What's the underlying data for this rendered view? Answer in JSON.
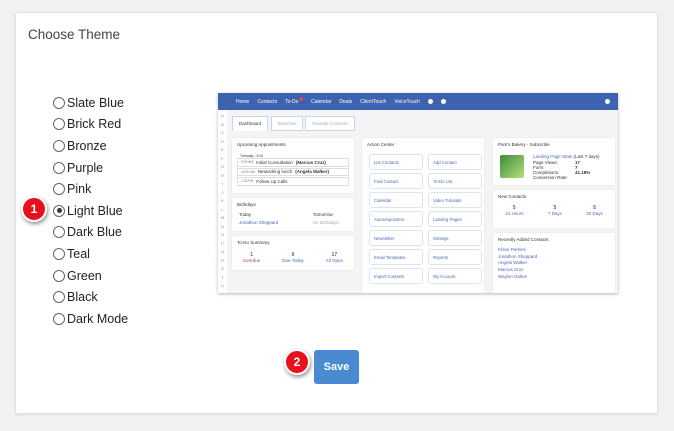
{
  "title": "Choose Theme",
  "themes": [
    "Slate Blue",
    "Brick Red",
    "Bronze",
    "Purple",
    "Pink",
    "Light Blue",
    "Dark Blue",
    "Teal",
    "Green",
    "Black",
    "Dark Mode"
  ],
  "selected_theme": "Light Blue",
  "badges": [
    "1",
    "2"
  ],
  "save_label": "Save",
  "preview": {
    "nav": [
      "Home",
      "Contacts",
      "To-Do",
      "Calendar",
      "Deals",
      "ClientTouch",
      "VoiceTouch"
    ],
    "todo_badges": [
      "1",
      "6"
    ],
    "alpha": [
      "A",
      "B",
      "C",
      "D",
      "E",
      "F",
      "G",
      "H",
      "I",
      "J",
      "K",
      "L",
      "M",
      "N",
      "O",
      "P",
      "Q",
      "R",
      "S",
      "T",
      "U"
    ],
    "tabs": [
      "Dashboard",
      "Searches",
      "Favorite Contacts"
    ],
    "appointments": {
      "title": "Upcoming Appointments",
      "date": "Tuesday - 4/10",
      "items": [
        {
          "time": "9:00 AM",
          "text": "Initial Consultation",
          "who": "(Marcus Cruz)"
        },
        {
          "time": "11:00 AM",
          "text": "Networking lunch",
          "who": "(Angela Walker)"
        },
        {
          "time": "1:00 PM",
          "text": "Follow Up Calls",
          "who": ""
        }
      ]
    },
    "birthdays": {
      "title": "Birthdays",
      "today": "Today",
      "tomorrow": "Tomorrow",
      "today_name": "Jonathon Sheppard",
      "tomorrow_text": "No Birthdays"
    },
    "todo": {
      "title": "To-Do Summary",
      "items": [
        {
          "n": "1",
          "label": "Overdue"
        },
        {
          "n": "6",
          "label": "Due Today"
        },
        {
          "n": "17",
          "label": "All Open"
        }
      ]
    },
    "action_center": {
      "title": "Action Center",
      "buttons": [
        "List Contacts",
        "Add Contact",
        "Find Contact",
        "To-Do List",
        "Calendar",
        "Video Tutorials",
        "Autoresponders",
        "Landing Pages",
        "Newsletter",
        "Settings",
        "Email Templates",
        "Reports",
        "Import Contacts",
        "My Account"
      ]
    },
    "landing": {
      "title": "Pam's Bakery - Subscribe",
      "link": "Landing Page Stats",
      "period": "(Last 7 days)",
      "rows": [
        {
          "k": "Page Views:",
          "v": "17"
        },
        {
          "k": "Form",
          "v": "7"
        },
        {
          "k": "Completions:",
          "v": "41.18%"
        },
        {
          "k": "Conversion Rate:",
          "v": ""
        }
      ]
    },
    "new_contacts": {
      "title": "New Contacts",
      "items": [
        {
          "n": "5",
          "label": "24 Hours"
        },
        {
          "n": "5",
          "label": "7 Days"
        },
        {
          "n": "5",
          "label": "30 Days"
        }
      ]
    },
    "recent": {
      "title": "Recently Added Contacts",
      "names": [
        "Khloe Perkins",
        "Jonathon Sheppard",
        "Angela Walker",
        "Marcus Cruz",
        "Waylon Dalton"
      ]
    }
  }
}
